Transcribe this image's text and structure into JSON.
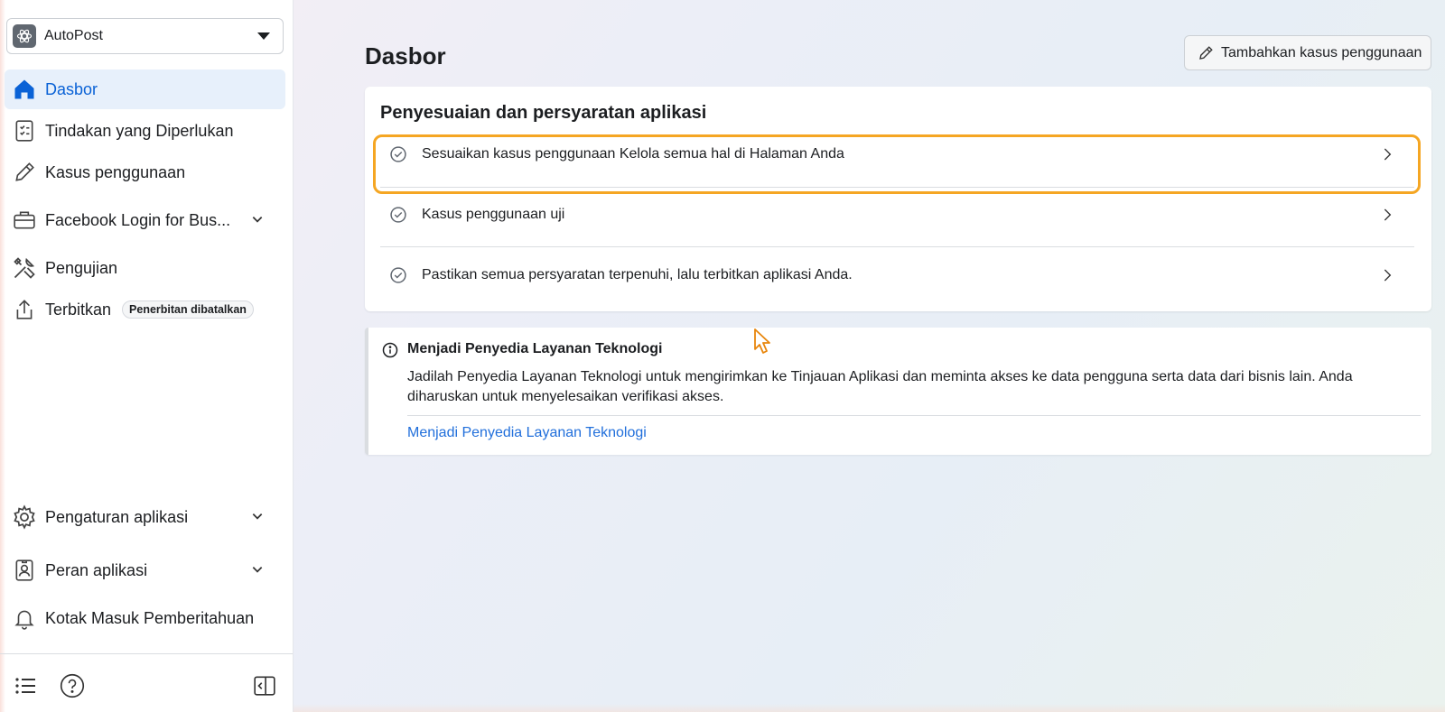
{
  "sidebar": {
    "app_name": "AutoPost",
    "items": [
      {
        "label": "Dasbor",
        "icon": "home-icon"
      },
      {
        "label": "Tindakan yang Diperlukan",
        "icon": "checklist-icon"
      },
      {
        "label": "Kasus penggunaan",
        "icon": "pencil-icon"
      },
      {
        "label": "Facebook Login for Bus...",
        "icon": "briefcase-icon"
      },
      {
        "label": "Pengujian",
        "icon": "tools-icon"
      },
      {
        "label": "Terbitkan",
        "icon": "upload-icon",
        "badge": "Penerbitan dibatalkan"
      },
      {
        "label": "Pengaturan aplikasi",
        "icon": "gear-icon"
      },
      {
        "label": "Peran aplikasi",
        "icon": "id-badge-icon"
      },
      {
        "label": "Kotak Masuk Pemberitahuan",
        "icon": "bell-icon"
      }
    ],
    "footer": {
      "list_icon": "list-icon",
      "help_icon": "help-icon",
      "collapse_icon": "collapse-panel-icon"
    }
  },
  "header": {
    "title": "Dasbor",
    "add_button_label": "Tambahkan kasus penggunaan"
  },
  "requirements": {
    "title": "Penyesuaian dan persyaratan aplikasi",
    "items": [
      "Sesuaikan kasus penggunaan Kelola semua hal di Halaman Anda",
      "Kasus penggunaan uji",
      "Pastikan semua persyaratan terpenuhi, lalu terbitkan aplikasi Anda."
    ]
  },
  "info": {
    "title": "Menjadi Penyedia Layanan Teknologi",
    "body": "Jadilah Penyedia Layanan Teknologi untuk mengirimkan ke Tinjauan Aplikasi dan meminta akses ke data pengguna serta data dari bisnis lain. Anda diharuskan untuk menyelesaikan verifikasi akses.",
    "link": "Menjadi Penyedia Layanan Teknologi"
  },
  "colors": {
    "accent": "#0a62d6",
    "highlight": "#f5a623",
    "link": "#216fdb"
  }
}
